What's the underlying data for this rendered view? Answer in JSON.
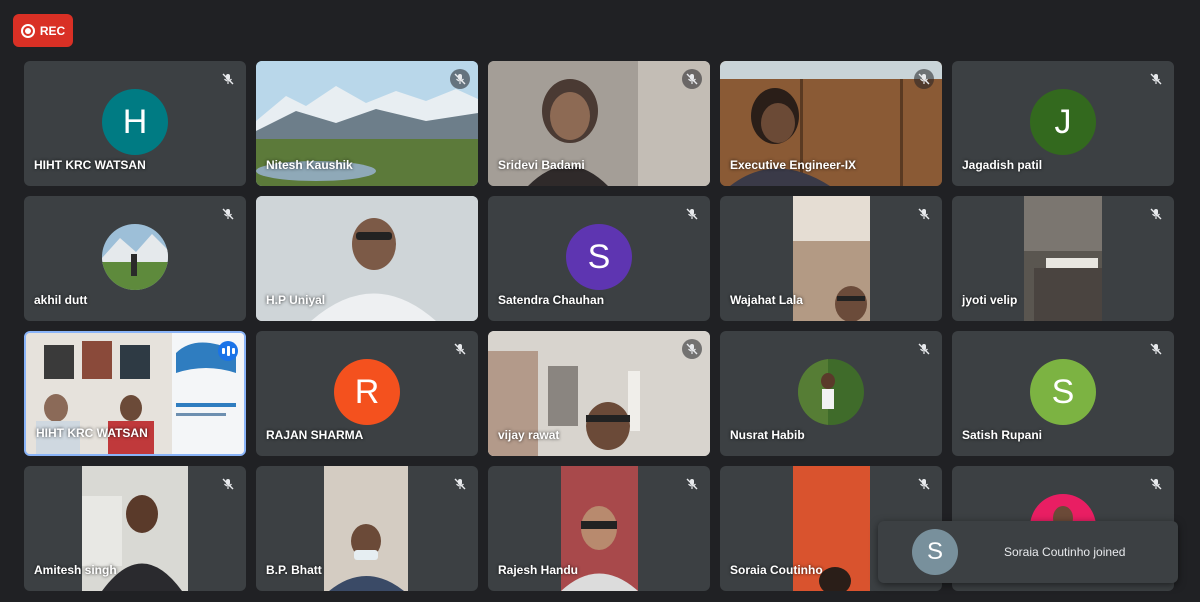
{
  "rec_label": "REC",
  "tiles": [
    {
      "name": "HIHT KRC WATSAN",
      "initial": "H",
      "color": "#007b83"
    },
    {
      "name": "Nitesh Kaushik"
    },
    {
      "name": "Sridevi Badami"
    },
    {
      "name": "Executive Engineer-IX"
    },
    {
      "name": "Jagadish patil",
      "initial": "J",
      "color": "#33691e"
    },
    {
      "name": "akhil dutt"
    },
    {
      "name": "H.P Uniyal"
    },
    {
      "name": "Satendra Chauhan",
      "initial": "S",
      "color": "#5e35b1"
    },
    {
      "name": "Wajahat Lala"
    },
    {
      "name": "jyoti velip"
    },
    {
      "name": "HIHT KRC WATSAN"
    },
    {
      "name": "RAJAN SHARMA",
      "initial": "R",
      "color": "#f4511e"
    },
    {
      "name": "vijay rawat"
    },
    {
      "name": "Nusrat Habib"
    },
    {
      "name": "Satish Rupani",
      "initial": "S",
      "color": "#7cb342"
    },
    {
      "name": "Amitesh singh"
    },
    {
      "name": "B.P. Bhatt"
    },
    {
      "name": "Rajesh Handu"
    },
    {
      "name": "Soraia Coutinho"
    },
    {
      "name": ""
    }
  ],
  "toast": {
    "initial": "S",
    "message": "Soraia Coutinho joined"
  }
}
